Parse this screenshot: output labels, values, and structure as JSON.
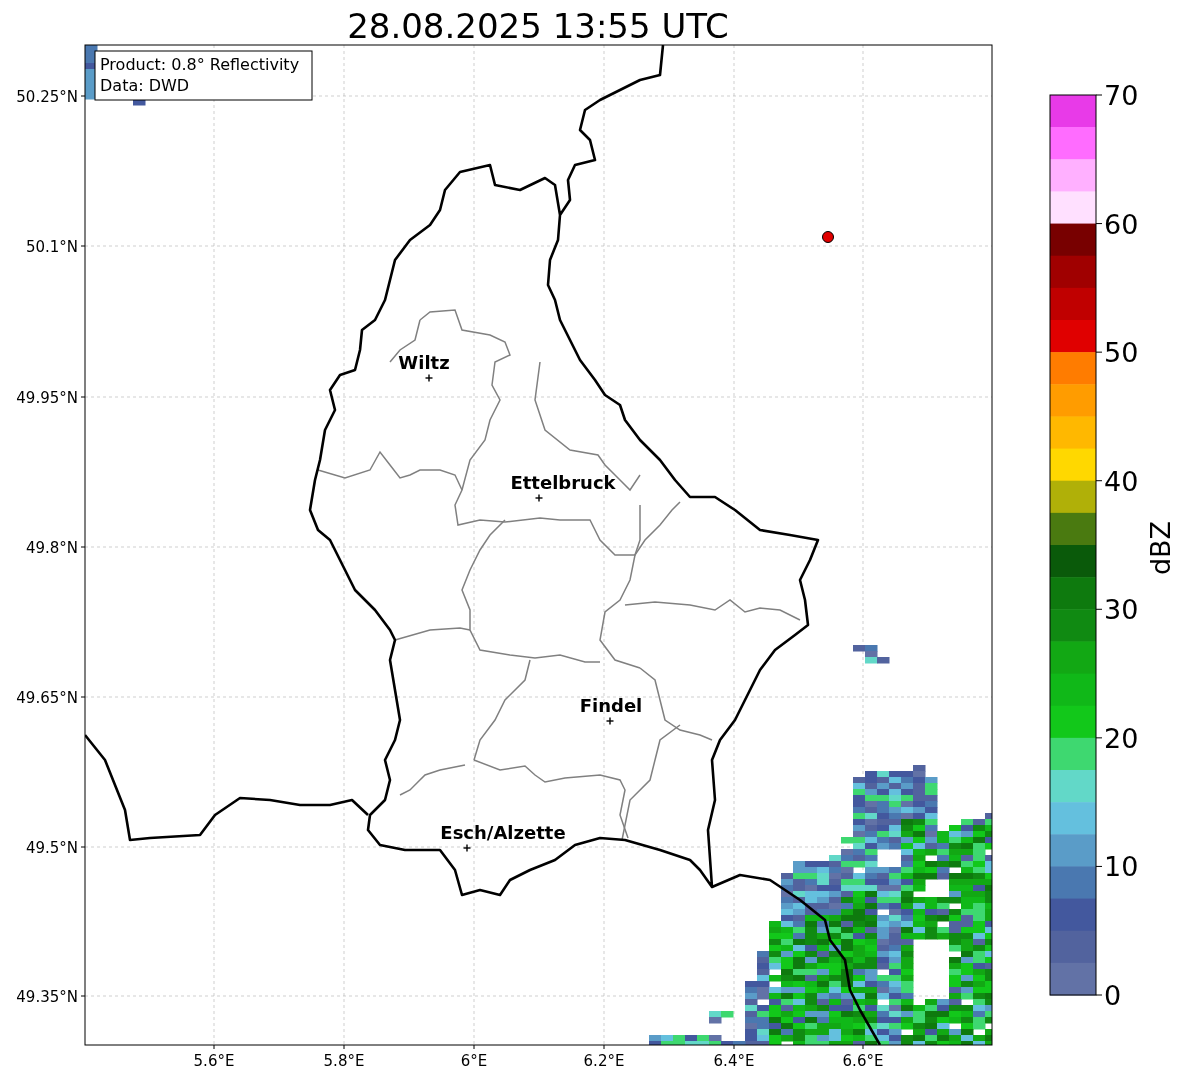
{
  "title": "28.08.2025 13:55 UTC",
  "info_box": [
    "Product: 0.8° Reflectivity",
    "Data: DWD"
  ],
  "cities": [
    {
      "name": "Wiltz"
    },
    {
      "name": "Ettelbruck"
    },
    {
      "name": "Findel"
    },
    {
      "name": "Esch/Alzette"
    }
  ],
  "lat_ticks": [
    "50.25°N",
    "50.1°N",
    "49.95°N",
    "49.8°N",
    "49.65°N",
    "49.5°N",
    "49.35°N"
  ],
  "lon_ticks": [
    "5.6°E",
    "5.8°E",
    "6°E",
    "6.2°E",
    "6.4°E",
    "6.6°E"
  ],
  "colorbar": {
    "label": "dBZ",
    "ticks": [
      "70",
      "60",
      "50",
      "40",
      "30",
      "20",
      "10",
      "0"
    ],
    "segments": [
      {
        "color": "#e83ae8"
      },
      {
        "color": "#ff6cff"
      },
      {
        "color": "#ffb0ff"
      },
      {
        "color": "#ffe0ff"
      },
      {
        "color": "#780000"
      },
      {
        "color": "#a00000"
      },
      {
        "color": "#c00000"
      },
      {
        "color": "#e00000"
      },
      {
        "color": "#ff7c00"
      },
      {
        "color": "#ff9c00"
      },
      {
        "color": "#ffb800"
      },
      {
        "color": "#ffd800"
      },
      {
        "color": "#b0b008"
      },
      {
        "color": "#4a7a10"
      },
      {
        "color": "#0a5a0a"
      },
      {
        "color": "#0e7a0e"
      },
      {
        "color": "#108a12"
      },
      {
        "color": "#12a814"
      },
      {
        "color": "#10b818"
      },
      {
        "color": "#12c81a"
      },
      {
        "color": "#3ed870"
      },
      {
        "color": "#62d8c8"
      },
      {
        "color": "#64c0de"
      },
      {
        "color": "#5a9cc8"
      },
      {
        "color": "#4a78b0"
      },
      {
        "color": "#43589e"
      },
      {
        "color": "#52639e"
      },
      {
        "color": "#6272a6"
      }
    ]
  }
}
